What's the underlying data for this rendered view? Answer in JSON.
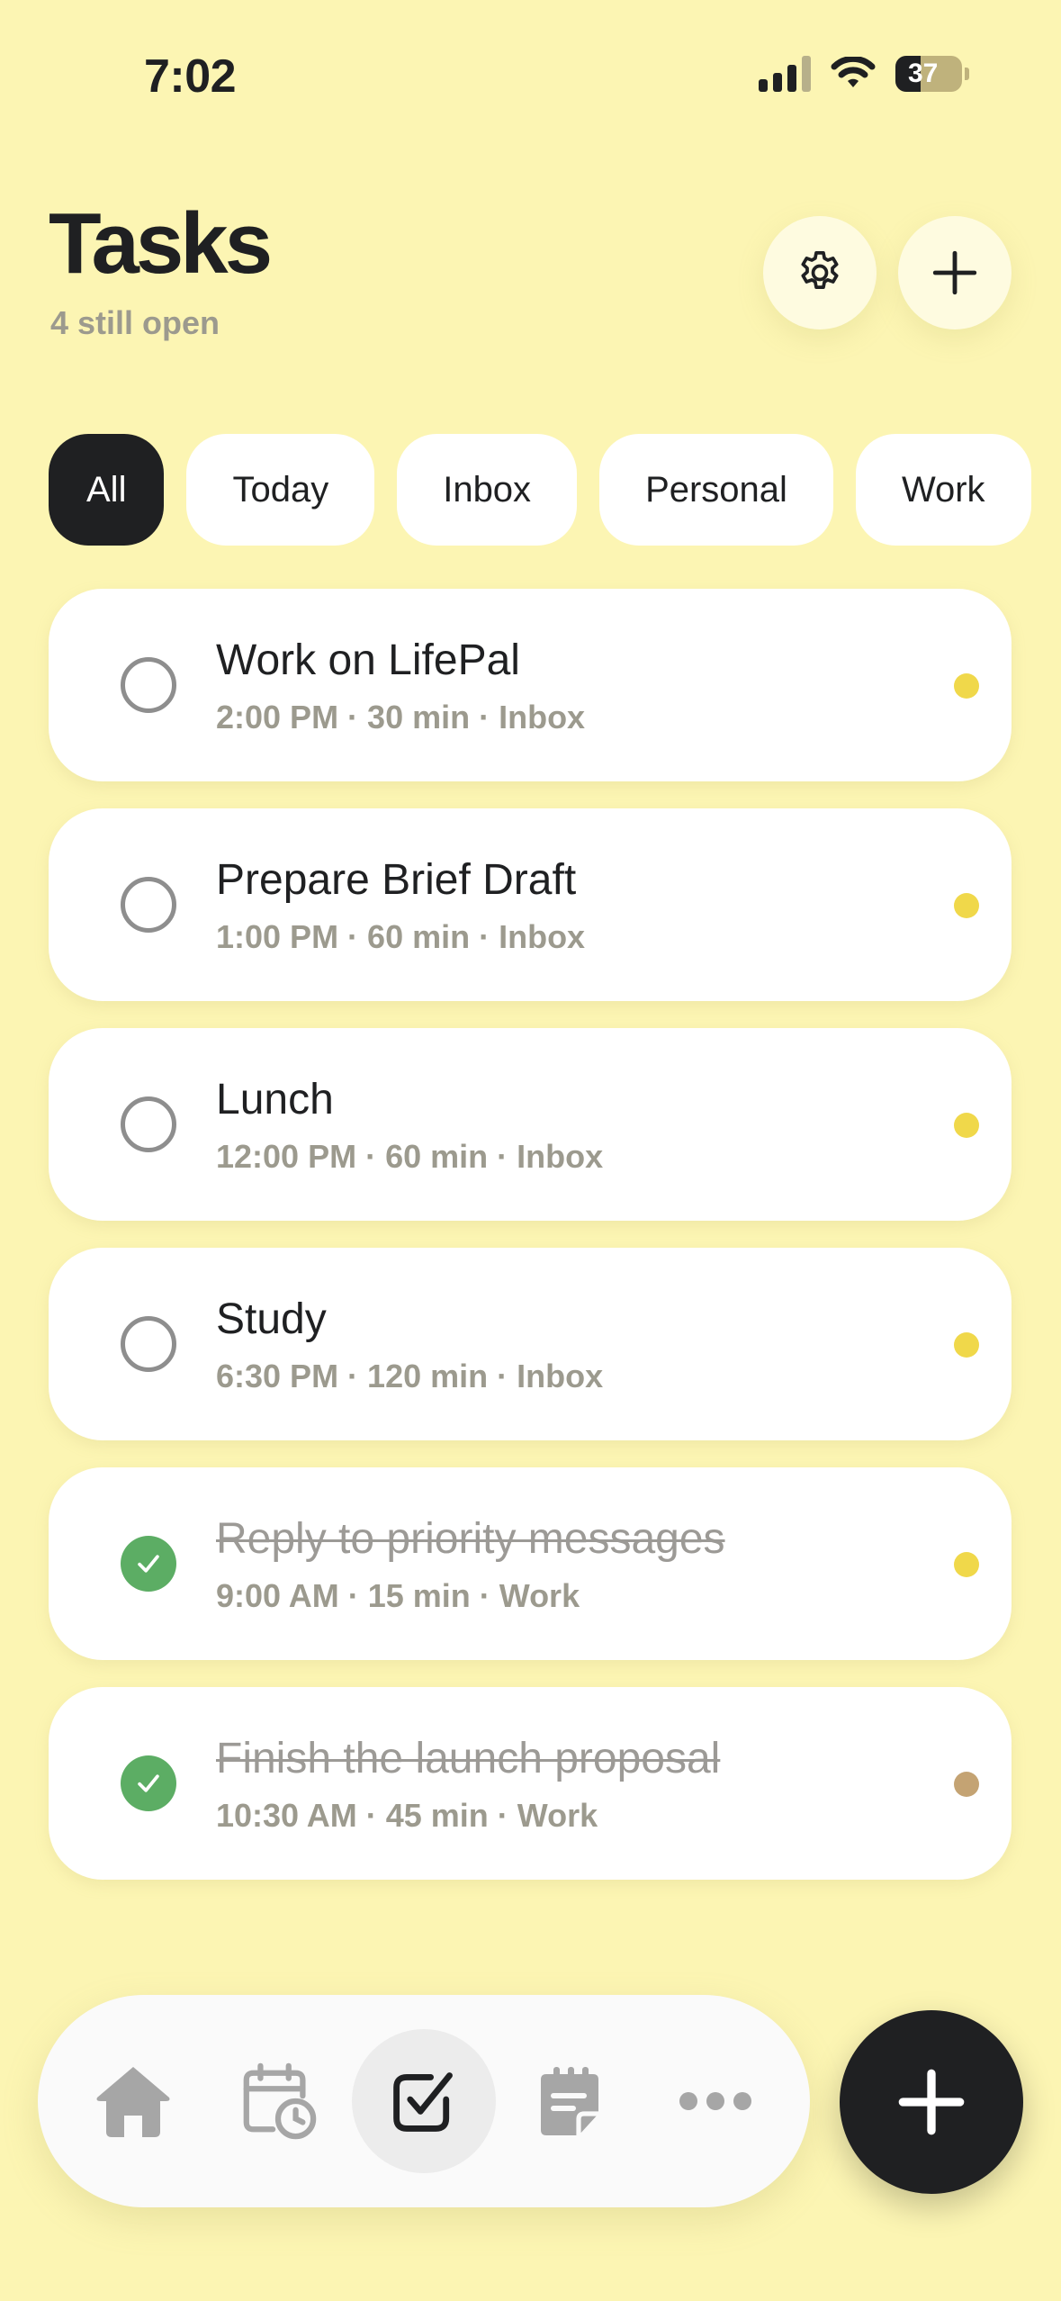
{
  "status_bar": {
    "time": "7:02",
    "battery": "37",
    "icons": [
      "cellular-signal-icon",
      "wifi-icon",
      "battery-icon"
    ]
  },
  "header": {
    "title": "Tasks",
    "subtitle": "4 still open",
    "settings_icon": "gear-icon",
    "add_icon": "plus-icon"
  },
  "filters": [
    {
      "label": "All",
      "active": true
    },
    {
      "label": "Today",
      "active": false
    },
    {
      "label": "Inbox",
      "active": false
    },
    {
      "label": "Personal",
      "active": false
    },
    {
      "label": "Work",
      "active": false
    }
  ],
  "tasks": [
    {
      "title": "Work on LifePal",
      "meta": "2:00 PM · 30 min · Inbox",
      "done": false,
      "dot_color": "#f0d84a"
    },
    {
      "title": "Prepare Brief Draft",
      "meta": "1:00 PM · 60 min · Inbox",
      "done": false,
      "dot_color": "#f0d84a"
    },
    {
      "title": "Lunch",
      "meta": "12:00 PM · 60 min · Inbox",
      "done": false,
      "dot_color": "#f0d84a"
    },
    {
      "title": "Study",
      "meta": "6:30 PM · 120 min · Inbox",
      "done": false,
      "dot_color": "#f0d84a"
    },
    {
      "title": "Reply to priority messages",
      "meta": "9:00 AM · 15 min · Work",
      "done": true,
      "dot_color": "#f0d84a"
    },
    {
      "title": "Finish the launch proposal",
      "meta": "10:30 AM · 45 min · Work",
      "done": true,
      "dot_color": "#c4a373"
    }
  ],
  "tab_bar": {
    "items": [
      "home-icon",
      "calendar-clock-icon",
      "tasks-check-icon",
      "notes-icon",
      "more-icon"
    ],
    "active": "tasks-check-icon"
  },
  "fab_icon": "plus-icon",
  "colors": {
    "background": "#fcf5b3",
    "card": "#ffffff",
    "dark": "#1f2022",
    "muted_text": "#9c9a8e",
    "done_green": "#5cad64"
  }
}
